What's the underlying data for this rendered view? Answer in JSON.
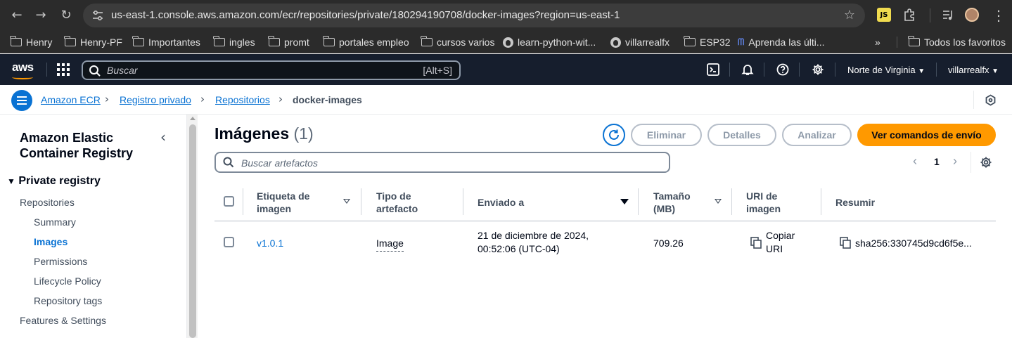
{
  "browser": {
    "url": "us-east-1.console.aws.amazon.com/ecr/repositories/private/180294190708/docker-images?region=us-east-1",
    "bookmarks": [
      {
        "label": "Henry",
        "icon": "folder-icon"
      },
      {
        "label": "Henry-PF",
        "icon": "folder-icon"
      },
      {
        "label": "Importantes",
        "icon": "folder-icon"
      },
      {
        "label": "ingles",
        "icon": "folder-icon"
      },
      {
        "label": "promt",
        "icon": "folder-icon"
      },
      {
        "label": "portales empleo",
        "icon": "folder-icon"
      },
      {
        "label": "cursos varios",
        "icon": "folder-icon"
      },
      {
        "label": "learn-python-wit...",
        "icon": "github-icon"
      },
      {
        "label": "villarrealfx",
        "icon": "github-icon"
      },
      {
        "label": "ESP32",
        "icon": "folder-icon"
      },
      {
        "label": "Aprenda las últi...",
        "icon": "site-icon"
      }
    ],
    "overflow": "»",
    "all_bookmarks": "Todos los favoritos"
  },
  "aws_header": {
    "logo": "aws",
    "search_placeholder": "Buscar",
    "search_shortcut": "[Alt+S]",
    "region": "Norte de Virginia",
    "account": "villarrealfx"
  },
  "breadcrumb": {
    "items": [
      "Amazon ECR",
      "Registro privado",
      "Repositorios"
    ],
    "current": "docker-images"
  },
  "sidebar": {
    "title_line1": "Amazon Elastic",
    "title_line2": "Container Registry",
    "section": "Private registry",
    "items": [
      {
        "label": "Repositories",
        "level": 1
      },
      {
        "label": "Summary",
        "level": 2
      },
      {
        "label": "Images",
        "level": 2,
        "active": true
      },
      {
        "label": "Permissions",
        "level": 2
      },
      {
        "label": "Lifecycle Policy",
        "level": 2
      },
      {
        "label": "Repository tags",
        "level": 2
      },
      {
        "label": "Features & Settings",
        "level": 1
      }
    ]
  },
  "main": {
    "title": "Imágenes",
    "count": "(1)",
    "buttons": {
      "delete": "Eliminar",
      "details": "Detalles",
      "scan": "Analizar",
      "push_commands": "Ver comandos de envío"
    },
    "filter_placeholder": "Buscar artefactos",
    "page": "1"
  },
  "table": {
    "headers": {
      "tag_l1": "Etiqueta de",
      "tag_l2": "imagen",
      "type_l1": "Tipo de",
      "type_l2": "artefacto",
      "pushed": "Enviado a",
      "size_l1": "Tamaño",
      "size_l2": "(MB)",
      "uri_l1": "URI de",
      "uri_l2": "imagen",
      "digest": "Resumir"
    },
    "rows": [
      {
        "tag": "v1.0.1",
        "type": "Image",
        "pushed_l1": "21 de diciembre de 2024,",
        "pushed_l2": "00:52:06 (UTC-04)",
        "size": "709.26",
        "uri_l1": "Copiar",
        "uri_l2": "URI",
        "digest": "sha256:330745d9cd6f5e..."
      }
    ]
  },
  "colors": {
    "aws_header": "#161e2d",
    "link": "#0972d3",
    "primary_button": "#ff9900",
    "chrome": "#2b2b2b"
  }
}
